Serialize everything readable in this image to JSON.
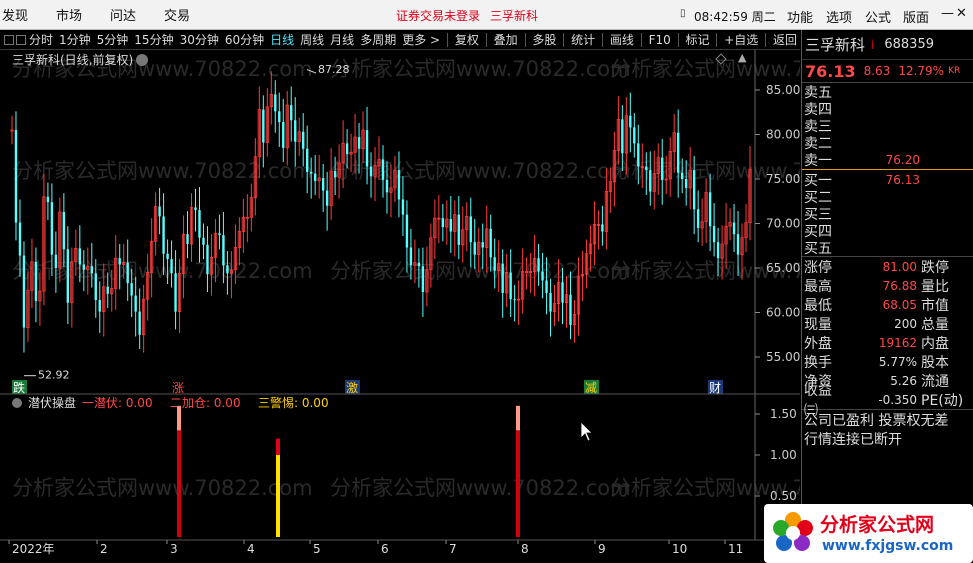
{
  "menubar": {
    "items": [
      "发现",
      "市场",
      "问达",
      "交易"
    ],
    "warning": "证券交易未登录",
    "stock": "三孚新科",
    "clock": "08:42:59 周二",
    "right_menu": [
      "功能",
      "选项",
      "公式",
      "版面"
    ]
  },
  "toolbar": {
    "periods": [
      "分时",
      "1分钟",
      "5分钟",
      "15分钟",
      "30分钟",
      "60分钟",
      "日线",
      "周线",
      "月线",
      "多周期",
      "更多 >"
    ],
    "selected_period": "日线",
    "tools": [
      "复权",
      "叠加",
      "多股",
      "统计",
      "画线",
      "F10",
      "标记",
      "+自选",
      "返回"
    ]
  },
  "chart": {
    "title": "三孚新科(日线,前复权)",
    "high_label": "87.28",
    "low_label": "52.92",
    "yticks": [
      "85.00",
      "80.00",
      "75.00",
      "70.00",
      "65.00",
      "60.00",
      "55.00"
    ],
    "xticks": [
      "2022年",
      "2",
      "3",
      "4",
      "5",
      "6",
      "7",
      "8",
      "9",
      "10",
      "11"
    ],
    "markers": [
      {
        "text": "跌",
        "color": "#ffffff",
        "bg": "#1a7a3a"
      },
      {
        "text": "涨",
        "color": "#ff4848",
        "bg": "#000000"
      },
      {
        "text": "激",
        "color": "#ffd200",
        "bg": "#1a3a7a"
      },
      {
        "text": "减",
        "color": "#ffd200",
        "bg": "#1a7a3a"
      },
      {
        "text": "财",
        "color": "#ffffff",
        "bg": "#1a3a7a"
      }
    ],
    "watermark": "分析家公式网www.70822.com"
  },
  "indicator": {
    "name": "潜伏操盘",
    "items": [
      {
        "label": "一潜伏:",
        "value": "0.00",
        "color": "#ff4848"
      },
      {
        "label": "二加仓:",
        "value": "0.00",
        "color": "#ff4848"
      },
      {
        "label": "三警惕:",
        "value": "0.00",
        "color": "#ffd200"
      }
    ],
    "yticks": [
      "1.50",
      "1.00",
      "0.50"
    ]
  },
  "panel": {
    "name": "三孚新科",
    "i_mark": "i",
    "code": "688359",
    "price": "76.13",
    "change": "8.63",
    "pct": "12.79%",
    "kr": "KR",
    "asks": [
      {
        "label": "卖五",
        "value": ""
      },
      {
        "label": "卖四",
        "value": ""
      },
      {
        "label": "卖三",
        "value": ""
      },
      {
        "label": "卖二",
        "value": ""
      },
      {
        "label": "卖一",
        "value": "76.20"
      }
    ],
    "bids": [
      {
        "label": "买一",
        "value": "76.13"
      },
      {
        "label": "买二",
        "value": ""
      },
      {
        "label": "买三",
        "value": ""
      },
      {
        "label": "买四",
        "value": ""
      },
      {
        "label": "买五",
        "value": ""
      }
    ],
    "stats": [
      {
        "l1": "涨停",
        "v1": "81.00",
        "c1": "red",
        "l2": "跌停"
      },
      {
        "l1": "最高",
        "v1": "76.88",
        "c1": "red",
        "l2": "量比"
      },
      {
        "l1": "最低",
        "v1": "68.05",
        "c1": "red",
        "l2": "市值"
      },
      {
        "l1": "现量",
        "v1": "200",
        "c1": "wht",
        "l2": "总量"
      },
      {
        "l1": "外盘",
        "v1": "19162",
        "c1": "red",
        "l2": "内盘"
      },
      {
        "l1": "换手",
        "v1": "5.77%",
        "c1": "wht",
        "l2": "股本"
      },
      {
        "l1": "净资",
        "v1": "5.26",
        "c1": "wht",
        "l2": "流通"
      },
      {
        "l1": "收益㈢",
        "v1": "-0.350",
        "c1": "wht",
        "l2": "PE(动)"
      }
    ],
    "notes": [
      "公司已盈利 投票权无差",
      "行情连接已断开"
    ]
  },
  "logo": {
    "title": "分析家公式网",
    "url": "www.fxjgsw.com"
  },
  "chart_data": {
    "type": "candlestick",
    "title": "三孚新科(日线,前复权)",
    "ylim": [
      52,
      88
    ],
    "period": "daily, 2022-01 to 2022-11",
    "closes": [
      80.5,
      70.1,
      66.4,
      58.3,
      62.5,
      65.7,
      61.3,
      62.4,
      73.0,
      72.4,
      66.5,
      65.0,
      71.3,
      67.1,
      61.1,
      65.7,
      67.2,
      65.4,
      64.8,
      65.2,
      64.4,
      61.4,
      60.1,
      62.9,
      62.1,
      62.7,
      66.1,
      65.4,
      65.6,
      63.3,
      61.9,
      60.1,
      57.5,
      61.5,
      64.5,
      68.0,
      71.9,
      70.8,
      66.6,
      66.0,
      64.4,
      60.1,
      64.4,
      68.8,
      67.7,
      71.8,
      71.5,
      68.4,
      67.6,
      64.3,
      66.2,
      68.9,
      68.7,
      65.3,
      64.4,
      64.8,
      67.3,
      69.1,
      70.7,
      70.7,
      72.9,
      77.5,
      82.8,
      79.1,
      83.1,
      84.5,
      82.6,
      81.4,
      78.5,
      83.3,
      81.6,
      79.2,
      80.3,
      78.4,
      75.8,
      75.6,
      74.8,
      75.1,
      73.7,
      72.0,
      75.9,
      75.2,
      76.8,
      79.0,
      77.8,
      78.0,
      79.7,
      78.4,
      80.5,
      76.4,
      75.3,
      76.5,
      77.2,
      74.9,
      73.5,
      74.0,
      76.0,
      72.7,
      71.0,
      67.3,
      65.3,
      65.6,
      65.2,
      62.3,
      64.8,
      68.4,
      70.6,
      70.6,
      69.6,
      70.5,
      69.1,
      71.0,
      67.6,
      69.3,
      70.8,
      67.9,
      66.5,
      67.9,
      67.3,
      69.4,
      66.2,
      64.7,
      65.5,
      62.2,
      64.5,
      61.5,
      61.4,
      61.5,
      64.6,
      64.6,
      64.6,
      66.1,
      64.6,
      63.6,
      62.2,
      60.1,
      61.0,
      63.4,
      61.1,
      62.0,
      58.6,
      59.8,
      64.1,
      64.3,
      66.6,
      67.7,
      69.9,
      69.9,
      69.1,
      73.6,
      74.7,
      78.2,
      81.7,
      77.9,
      82.1,
      80.8,
      79.0,
      76.4,
      76.4,
      76.0,
      73.6,
      75.6,
      77.4,
      74.9,
      75.0,
      78.1,
      80.2,
      75.7,
      75.0,
      74.0,
      76.0,
      71.6,
      69.5,
      70.2,
      73.5,
      69.7,
      67.9,
      66.1,
      67.7,
      69.7,
      70.1,
      68.8,
      66.5,
      68.4,
      70.1,
      76.1
    ],
    "indicator_bars": [
      {
        "month": "3",
        "value": 1.6,
        "type": "一潜伏"
      },
      {
        "month": "4",
        "value": 1.2,
        "type": "三警惕"
      },
      {
        "month": "8",
        "value": 1.6,
        "type": "一潜伏"
      }
    ]
  }
}
